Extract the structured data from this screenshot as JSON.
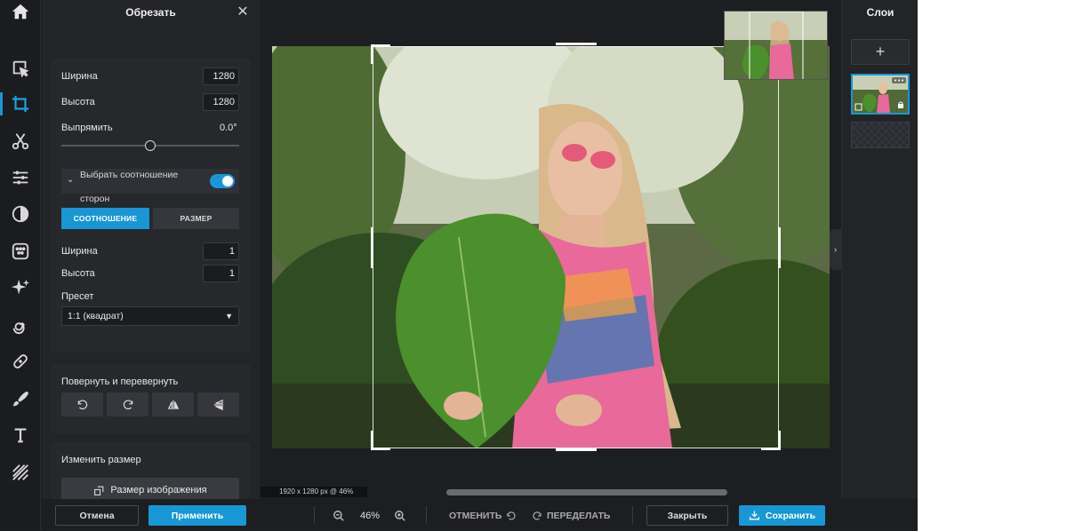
{
  "crop_panel": {
    "title": "Обрезать",
    "width_label": "Ширина",
    "width_value": "1280",
    "height_label": "Высота",
    "height_value": "1280",
    "straighten_label": "Выпрямить",
    "straighten_value": "0.0°",
    "aspect_toggle_label": "Выбрать соотношение сторон",
    "aspect_toggle_on": true,
    "seg_ratio": "СООТНОШЕНИЕ",
    "seg_size": "РАЗМЕР",
    "ratio_width_label": "Ширина",
    "ratio_width_value": "1",
    "ratio_height_label": "Высота",
    "ratio_height_value": "1",
    "preset_label": "Пресет",
    "preset_value": "1:1 (квадрат)",
    "rotate_title": "Повернуть и перевернуть",
    "resize_title": "Изменить размер",
    "image_size_button": "Размер изображения"
  },
  "bottom_bar": {
    "cancel": "Отмена",
    "apply": "Применить",
    "zoom": "46%",
    "undo": "ОТМЕНИТЬ",
    "redo": "ПЕРЕДЕЛАТЬ",
    "close": "Закрыть",
    "save": "Сохранить"
  },
  "canvas": {
    "size_readout": "1920 x 1280 px @ 46%"
  },
  "layers": {
    "title": "Слои"
  },
  "colors": {
    "accent": "#1996d4",
    "background": "#1d1e21",
    "panel": "#232428"
  },
  "icons": [
    "home-icon",
    "select-icon",
    "crop-icon",
    "cut-icon",
    "adjust-icon",
    "filter-icon",
    "effects-icon",
    "ai-icon",
    "liquify-icon",
    "heal-icon",
    "brush-icon",
    "text-icon",
    "pattern-icon"
  ]
}
